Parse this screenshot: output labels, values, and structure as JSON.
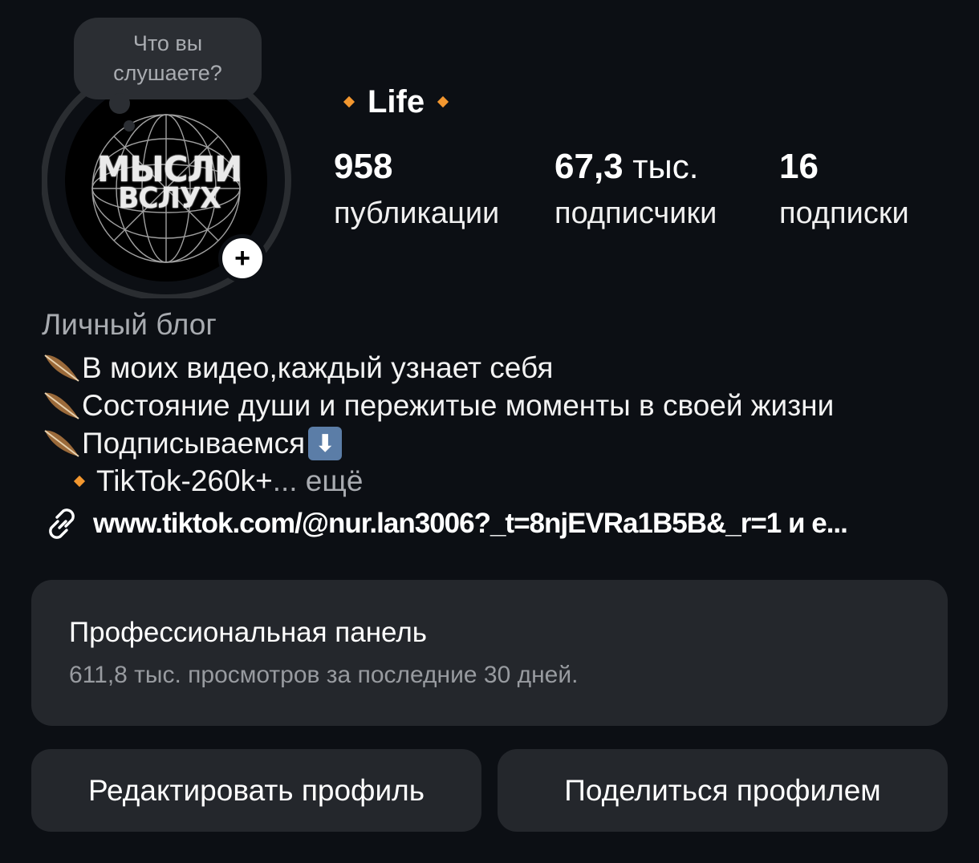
{
  "note": {
    "text_line1": "Что вы",
    "text_line2": "слушаете?"
  },
  "avatar": {
    "logo_line1": "МЫСЛИ",
    "logo_line2": "ВСЛУХ",
    "add_symbol": "+"
  },
  "profile": {
    "name": "Life",
    "accent_color": "#f3972f"
  },
  "stats": {
    "posts": {
      "value": "958",
      "label": "публикации"
    },
    "followers": {
      "value": "67,3",
      "unit": " тыс.",
      "label": "подписчики"
    },
    "following": {
      "value": "16",
      "label": "подписки"
    }
  },
  "bio": {
    "category": "Личный блог",
    "line1": "В моих видео,каждый узнает себя",
    "line2": "Состояние души и пережитые моменты в своей жизни",
    "line3": "Подписываемся",
    "line3_emoji": "⬇",
    "line4": "TikTok-260k+",
    "more": "... ещё"
  },
  "link": {
    "text": "www.tiktok.com/@nur.lan3006?_t=8njEVRa1B5B&_r=1 и е..."
  },
  "professional": {
    "title": "Профессиональная панель",
    "subtitle": "611,8 тыс. просмотров за последние 30 дней."
  },
  "buttons": {
    "edit": "Редактировать профиль",
    "share": "Поделиться профилем"
  },
  "colors": {
    "background": "#0c0f14",
    "card": "#24272c",
    "muted": "#a8abb0"
  }
}
